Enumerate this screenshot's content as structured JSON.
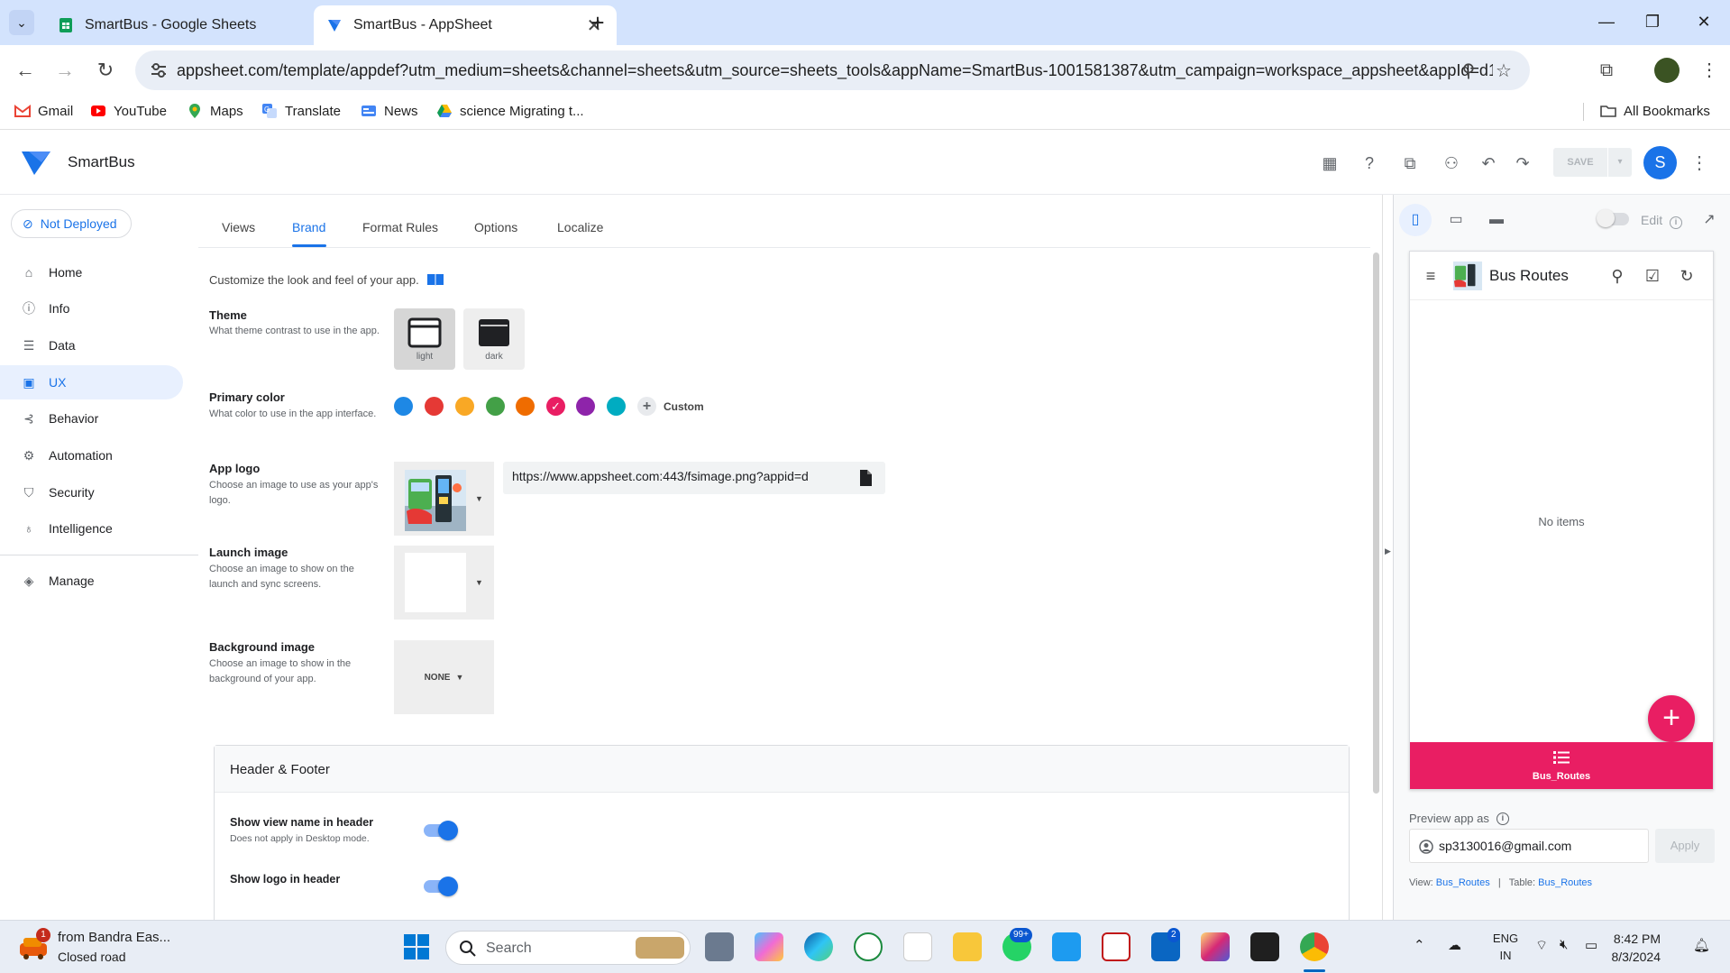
{
  "browser": {
    "tabs": [
      {
        "title": "SmartBus - Google Sheets",
        "active": false
      },
      {
        "title": "SmartBus - AppSheet",
        "active": true
      }
    ],
    "url": "appsheet.com/template/appdef?utm_medium=sheets&channel=sheets&utm_source=sheets_tools&appName=SmartBus-1001581387&utm_campaign=workspace_appsheet&appId=d1f6...",
    "bookmarks": [
      "Gmail",
      "YouTube",
      "Maps",
      "Translate",
      "News",
      "science Migrating t..."
    ],
    "all_bookmarks": "All Bookmarks"
  },
  "app": {
    "name": "SmartBus",
    "save_label": "SAVE",
    "user_initial": "S"
  },
  "sidebar": {
    "deploy_status": "Not Deployed",
    "items": [
      {
        "label": "Home",
        "icon": "home-icon"
      },
      {
        "label": "Info",
        "icon": "info-icon"
      },
      {
        "label": "Data",
        "icon": "data-icon"
      },
      {
        "label": "UX",
        "icon": "ux-icon",
        "active": true
      },
      {
        "label": "Behavior",
        "icon": "behavior-icon"
      },
      {
        "label": "Automation",
        "icon": "automation-icon"
      },
      {
        "label": "Security",
        "icon": "shield-icon"
      },
      {
        "label": "Intelligence",
        "icon": "lightbulb-icon"
      },
      {
        "label": "Manage",
        "icon": "manage-icon"
      }
    ]
  },
  "editor": {
    "tabs": [
      "Views",
      "Brand",
      "Format Rules",
      "Options",
      "Localize"
    ],
    "active_tab": "Brand",
    "description": "Customize the look and feel of your app.",
    "theme": {
      "title": "Theme",
      "help": "What theme contrast to use in the app.",
      "options": [
        "light",
        "dark"
      ],
      "selected": "light"
    },
    "primary_color": {
      "title": "Primary color",
      "help": "What color to use in the app interface.",
      "colors": [
        "#1e88e5",
        "#e53935",
        "#f9a825",
        "#43a047",
        "#ef6c00",
        "#e91e63",
        "#8e24aa",
        "#00acc1"
      ],
      "selected_index": 5,
      "custom_label": "Custom"
    },
    "app_logo": {
      "title": "App logo",
      "help": "Choose an image to use as your app's logo.",
      "url": "https://www.appsheet.com:443/fsimage.png?appid=d"
    },
    "launch_image": {
      "title": "Launch image",
      "help": "Choose an image to show on the launch and sync screens."
    },
    "background_image": {
      "title": "Background image",
      "help": "Choose an image to show in the background of your app.",
      "value": "NONE"
    },
    "header_footer": {
      "title": "Header & Footer",
      "show_view_name": {
        "label": "Show view name in header",
        "help": "Does not apply in Desktop mode.",
        "on": true
      },
      "show_logo": {
        "label": "Show logo in header",
        "on": true
      }
    }
  },
  "preview": {
    "edit_label": "Edit",
    "app_title": "Bus Routes",
    "empty_text": "No items",
    "bottom_nav_label": "Bus_Routes",
    "preview_as_label": "Preview app as",
    "email": "sp3130016@gmail.com",
    "apply_label": "Apply",
    "view_label": "View:",
    "view_value": "Bus_Routes",
    "table_label": "Table:",
    "table_value": "Bus_Routes",
    "accent": "#e91e63"
  },
  "taskbar": {
    "weather_line1": "from Bandra Eas...",
    "weather_line2": "Closed road",
    "weather_badge": "1",
    "search_placeholder": "Search",
    "whatsapp_badge": "99+",
    "linkedin_badge": "2",
    "lang_line1": "ENG",
    "lang_line2": "IN",
    "time": "8:42 PM",
    "date": "8/3/2024"
  }
}
